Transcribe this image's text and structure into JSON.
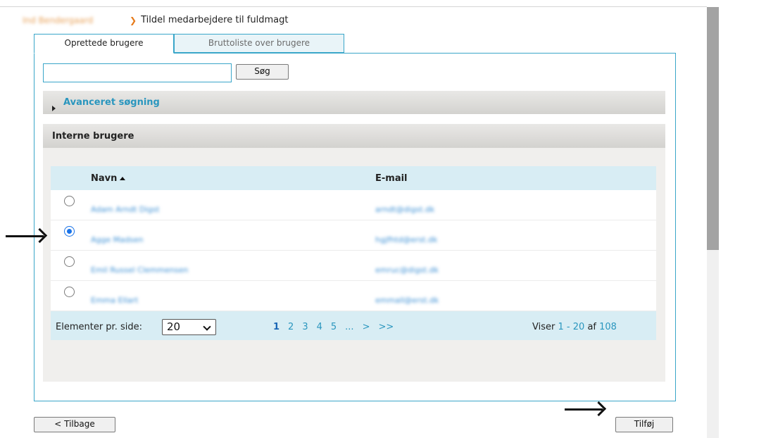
{
  "breadcrumb": {
    "user": "Ind Bendergaard",
    "separator": "❯",
    "title": "Tildel medarbejdere til fuldmagt"
  },
  "tabs": [
    {
      "label": "Oprettede brugere",
      "active": true
    },
    {
      "label": "Bruttoliste over brugere",
      "active": false
    }
  ],
  "search": {
    "value": "",
    "placeholder": "",
    "button_label": "Søg"
  },
  "advanced": {
    "label": "Avanceret søgning"
  },
  "section": {
    "title": "Interne brugere"
  },
  "table": {
    "columns": [
      "Navn",
      "E-mail"
    ],
    "rows": [
      {
        "name": "Adam Arndt Digst",
        "email": "arndt@digst.dk",
        "selected": false
      },
      {
        "name": "Agge Madsen",
        "email": "hgjfhtd@erst.dk",
        "selected": true
      },
      {
        "name": "Emil Russel Clemmensen",
        "email": "emruc@digst.dk",
        "selected": false
      },
      {
        "name": "Emma Ellart",
        "email": "emmall@erst.dk",
        "selected": false
      }
    ]
  },
  "footer": {
    "per_page_label": "Elementer pr. side:",
    "per_page_value": "20",
    "pages": [
      "1",
      "2",
      "3",
      "4",
      "5",
      "...",
      ">",
      ">>"
    ],
    "current_page": "1",
    "showing_prefix": "Viser",
    "showing_from": "1",
    "showing_dash": "-",
    "showing_to": "20",
    "showing_of": "af",
    "showing_total": "108"
  },
  "buttons": {
    "back_label": "< Tilbage",
    "add_label": "Tilføj"
  },
  "colors": {
    "accent": "#3aa6c9",
    "link": "#2a96be",
    "header_bg": "#d8edf4",
    "radio_selected": "#1a73e8"
  }
}
